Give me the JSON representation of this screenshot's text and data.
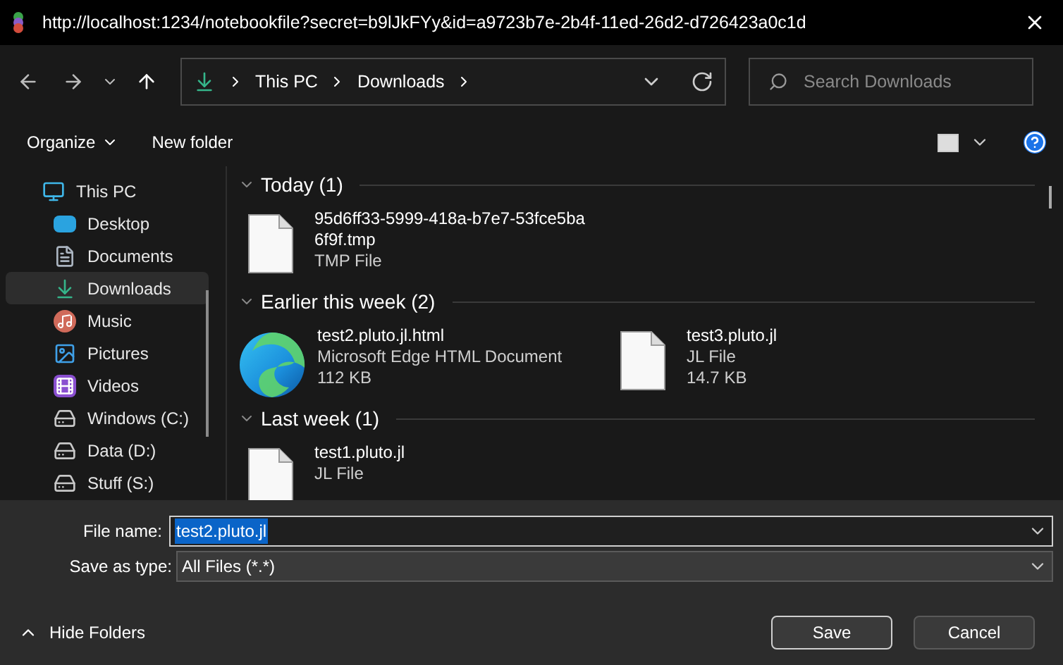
{
  "window": {
    "title": "http://localhost:1234/notebookfile?secret=b9lJkFYy&id=a9723b7e-2b4f-11ed-26d2-d726423a0c1d"
  },
  "breadcrumb": [
    "This PC",
    "Downloads"
  ],
  "search": {
    "placeholder": "Search Downloads"
  },
  "commands": [
    "Organize",
    "New folder"
  ],
  "sidebar": {
    "items": [
      {
        "label": "This PC",
        "kind": "pc",
        "selected": false,
        "children": [
          {
            "label": "Desktop",
            "kind": "desktop",
            "selected": false
          },
          {
            "label": "Documents",
            "kind": "documents",
            "selected": false
          },
          {
            "label": "Downloads",
            "kind": "downloads",
            "selected": true
          },
          {
            "label": "Music",
            "kind": "music",
            "selected": false
          },
          {
            "label": "Pictures",
            "kind": "pictures",
            "selected": false
          },
          {
            "label": "Videos",
            "kind": "videos",
            "selected": false
          },
          {
            "label": "Windows (C:)",
            "kind": "windows-drive",
            "selected": false
          },
          {
            "label": "Data (D:)",
            "kind": "drive",
            "selected": false
          },
          {
            "label": "Stuff (S:)",
            "kind": "drive",
            "selected": false
          }
        ]
      }
    ]
  },
  "groups": [
    {
      "title": "Today (1)",
      "expanded": true,
      "files": [
        {
          "kind": "generic",
          "name": "95d6ff33-5999-418a-b7e7-53fce5ba 6f9f.tmp",
          "type": "TMP File"
        }
      ]
    },
    {
      "title": "Earlier this week (2)",
      "expanded": true,
      "files": [
        {
          "kind": "edge",
          "name": "test2.pluto.jl.html",
          "type": "Microsoft Edge HTML Document",
          "size": "112 KB"
        },
        {
          "kind": "generic",
          "name": "test3.pluto.jl",
          "type": "JL File",
          "size": "14.7 KB"
        }
      ]
    },
    {
      "title": "Last week (1)",
      "expanded": true,
      "files": [
        {
          "kind": "generic",
          "name": "test1.pluto.jl",
          "type": "JL File"
        }
      ]
    }
  ],
  "file_name": {
    "label": "File name:",
    "value": "test2.pluto.jl"
  },
  "save_type": {
    "label": "Save as type:",
    "value": "All Files (*.*)"
  },
  "hide_folders": "Hide Folders",
  "buttons": [
    "Save",
    "Cancel"
  ]
}
